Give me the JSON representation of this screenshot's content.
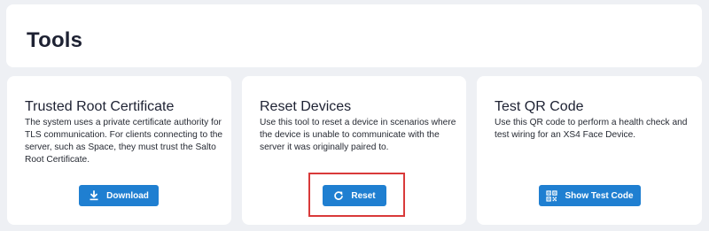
{
  "header": {
    "title": "Tools"
  },
  "cards": [
    {
      "title": "Trusted Root Certificate",
      "description": "The system uses a private certificate authority for TLS communication. For clients connecting to the server, such as Space, they must trust the Salto Root Certificate.",
      "button_label": "Download",
      "button_icon": "download-icon"
    },
    {
      "title": "Reset Devices",
      "description": "Use this tool to reset a device in scenarios where the device is unable to communicate with the server it was originally paired to.",
      "button_label": "Reset",
      "button_icon": "refresh-icon"
    },
    {
      "title": "Test QR Code",
      "description": "Use this QR code to perform a health check and test wiring for an XS4 Face Device.",
      "button_label": "Show Test Code",
      "button_icon": "qr-code-icon"
    }
  ],
  "colors": {
    "background": "#eef0f4",
    "card": "#ffffff",
    "primary_button": "#1f7fd1",
    "highlight": "#d93a3a"
  }
}
